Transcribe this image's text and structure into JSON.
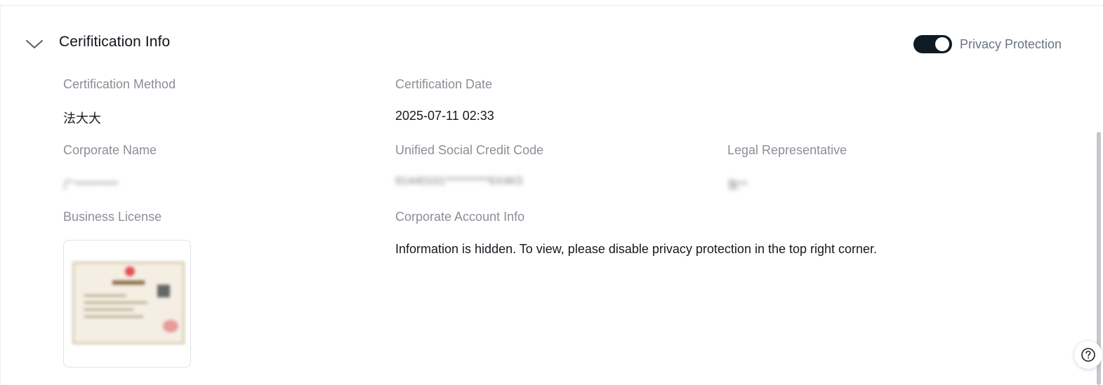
{
  "section": {
    "title": "Cerifitication Info",
    "chevron_icon": "chevron-down-icon"
  },
  "privacy": {
    "label": "Privacy Protection",
    "enabled": true
  },
  "fields": {
    "certification_method": {
      "label": "Certification Method",
      "value": "法大大"
    },
    "certification_date": {
      "label": "Certification Date",
      "value": "2025-07-11 02:33"
    },
    "corporate_name": {
      "label": "Corporate Name",
      "value": "广**********"
    },
    "unified_social_credit_code": {
      "label": "Unified Social Credit Code",
      "value": "91440101**********6X4K5"
    },
    "legal_representative": {
      "label": "Legal Representative",
      "value": "张**"
    },
    "business_license": {
      "label": "Business License"
    },
    "corporate_account_info": {
      "label": "Corporate Account Info",
      "value": "Information is hidden. To view, please disable privacy protection in the top right corner."
    }
  },
  "help": {
    "icon": "question-circle-icon"
  },
  "colors": {
    "toggle_on": "#0f1b24",
    "label_gray": "#8a8f97",
    "text_dark": "#15191e"
  }
}
